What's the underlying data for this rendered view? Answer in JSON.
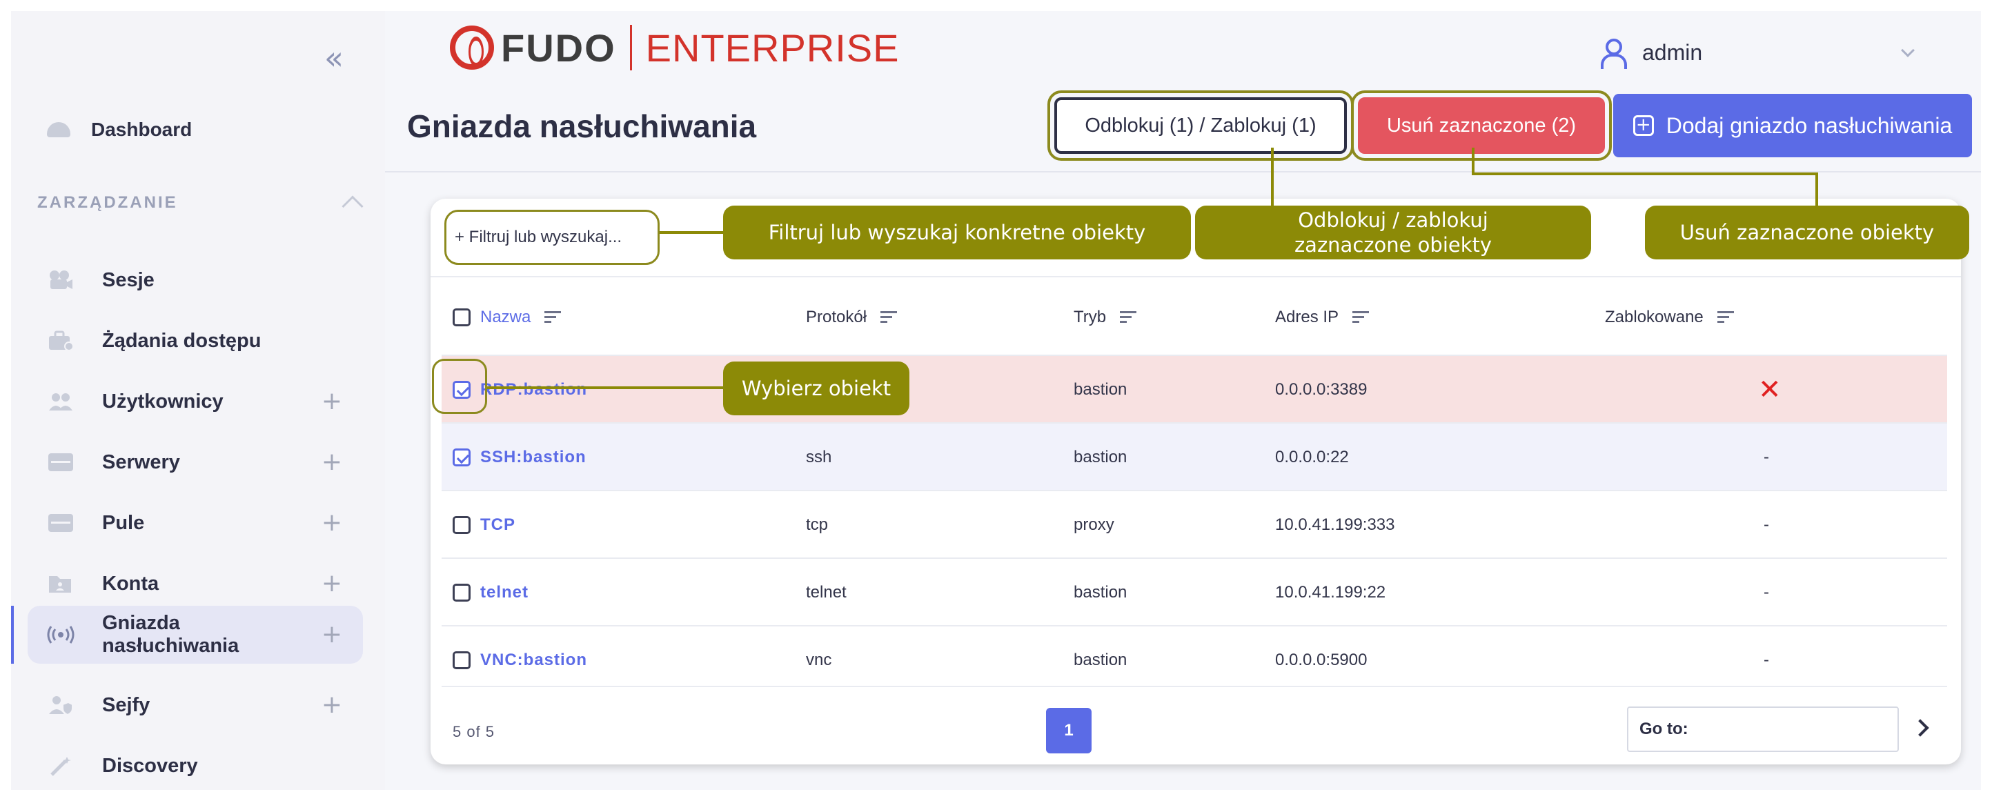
{
  "sidebar": {
    "collapse_glyph": "«",
    "dashboard": "Dashboard",
    "section": "ZARZĄDZANIE",
    "items": [
      {
        "label": "Sesje",
        "plus": "",
        "icon": "camera-icon"
      },
      {
        "label": "Żądania dostępu",
        "plus": "",
        "icon": "briefcase-icon"
      },
      {
        "label": "Użytkownicy",
        "plus": "+",
        "icon": "users-icon"
      },
      {
        "label": "Serwery",
        "plus": "+",
        "icon": "server-icon"
      },
      {
        "label": "Pule",
        "plus": "+",
        "icon": "pool-icon"
      },
      {
        "label": "Konta",
        "plus": "+",
        "icon": "account-icon"
      },
      {
        "label": "Gniazda nasłuchiwania",
        "plus": "+",
        "icon": "listener-icon",
        "active": true
      },
      {
        "label": "Sejfy",
        "plus": "+",
        "icon": "safe-icon"
      },
      {
        "label": "Discovery",
        "plus": "",
        "icon": "wand-icon"
      }
    ]
  },
  "header": {
    "logo_fudo": "FUDO",
    "logo_enterprise": "ENTERPRISE",
    "user": "admin",
    "title": "Gniazda nasłuchiwania",
    "btn_lock": "Odblokuj (1) / Zablokuj (1)",
    "btn_delete": "Usuń zaznaczone (2)",
    "btn_add": "Dodaj gniazdo nasłuchiwania",
    "btn_add_glyph": "+"
  },
  "filter": {
    "placeholder": "+ Filtruj lub wyszukaj..."
  },
  "table": {
    "columns": [
      "Nazwa",
      "Protokół",
      "Tryb",
      "Adres IP",
      "Zablokowane"
    ],
    "rows": [
      {
        "name": "RDP:bastion",
        "protocol": "",
        "mode": "bastion",
        "ip": "0.0.0.0:3389",
        "locked": "✕",
        "checked": true
      },
      {
        "name": "SSH:bastion",
        "protocol": "ssh",
        "mode": "bastion",
        "ip": "0.0.0.0:22",
        "locked": "-",
        "checked": true
      },
      {
        "name": "TCP",
        "protocol": "tcp",
        "mode": "proxy",
        "ip": "10.0.41.199:333",
        "locked": "-",
        "checked": false
      },
      {
        "name": "telnet",
        "protocol": "telnet",
        "mode": "bastion",
        "ip": "10.0.41.199:22",
        "locked": "-",
        "checked": false
      },
      {
        "name": "VNC:bastion",
        "protocol": "vnc",
        "mode": "bastion",
        "ip": "0.0.0.0:5900",
        "locked": "-",
        "checked": false
      }
    ]
  },
  "pagination": {
    "count": "5 of 5",
    "page": "1",
    "goto": "Go to:"
  },
  "annotations": {
    "filter": "Filtruj lub wyszukaj konkretne obiekty",
    "lock_line1": "Odblokuj / zablokuj",
    "lock_line2": "zaznaczone obiekty",
    "delete": "Usuń zaznaczone obiekty",
    "select": "Wybierz obiekt"
  },
  "colors": {
    "accent": "#5b6be6",
    "danger": "#e4555f",
    "annotation": "#8c8a07",
    "selected_row": "#f8e1e1"
  }
}
